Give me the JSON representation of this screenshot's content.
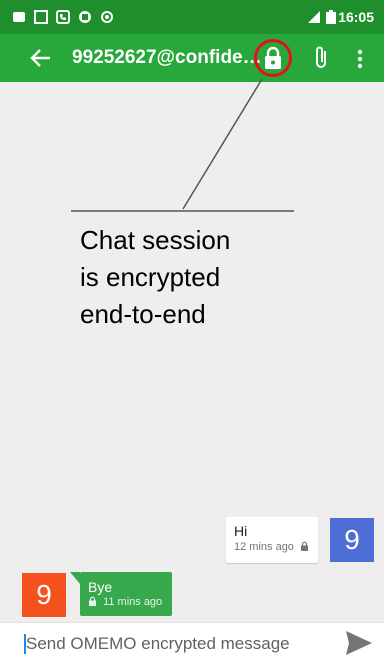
{
  "status_bar": {
    "time": "16:05",
    "left_icons": [
      "notification-icon",
      "screenshot-icon",
      "phone-icon",
      "app-icon",
      "location-icon"
    ],
    "right_icons": [
      "signal-icon",
      "battery-icon"
    ]
  },
  "toolbar": {
    "title": "99252627@confide…",
    "icons": [
      "back-arrow-icon",
      "lock-icon",
      "attachment-icon",
      "more-vert-icon"
    ]
  },
  "annotation": {
    "text": "Chat session\nis encrypted\nend-to-end"
  },
  "messages": [
    {
      "direction": "outgoing",
      "text": "Hi",
      "time": "12 mins ago",
      "avatar_letter": "9",
      "encrypted": true
    },
    {
      "direction": "incoming",
      "text": "Bye",
      "time": "11 mins ago",
      "avatar_letter": "9",
      "encrypted": true
    }
  ],
  "composer": {
    "placeholder": "Send OMEMO encrypted message",
    "value": ""
  },
  "colors": {
    "status_bar": "#1e8f2c",
    "toolbar": "#28a73a",
    "incoming_bubble": "#38a84c",
    "outgoing_avatar": "#4e6ed6",
    "incoming_avatar": "#f4511e",
    "highlight_ring": "#e6101d"
  }
}
